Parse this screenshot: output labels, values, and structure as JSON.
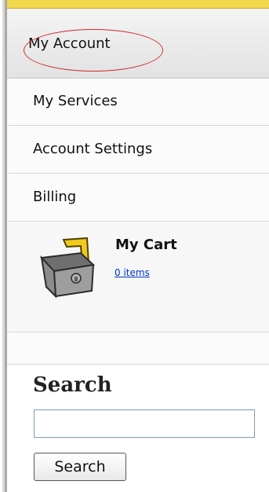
{
  "nav": {
    "header_label": "My Account",
    "items": [
      {
        "label": "My Services"
      },
      {
        "label": "Account Settings"
      },
      {
        "label": "Billing"
      }
    ]
  },
  "cart": {
    "title": "My Cart",
    "items_link": "0 items",
    "icon": "shopping-basket-icon"
  },
  "search": {
    "title": "Search",
    "input_value": "",
    "input_placeholder": "",
    "button_label": "Search"
  },
  "colors": {
    "accent_yellow": "#f2d84c",
    "highlight_red": "#d22a2a",
    "link_blue": "#0033cc"
  }
}
